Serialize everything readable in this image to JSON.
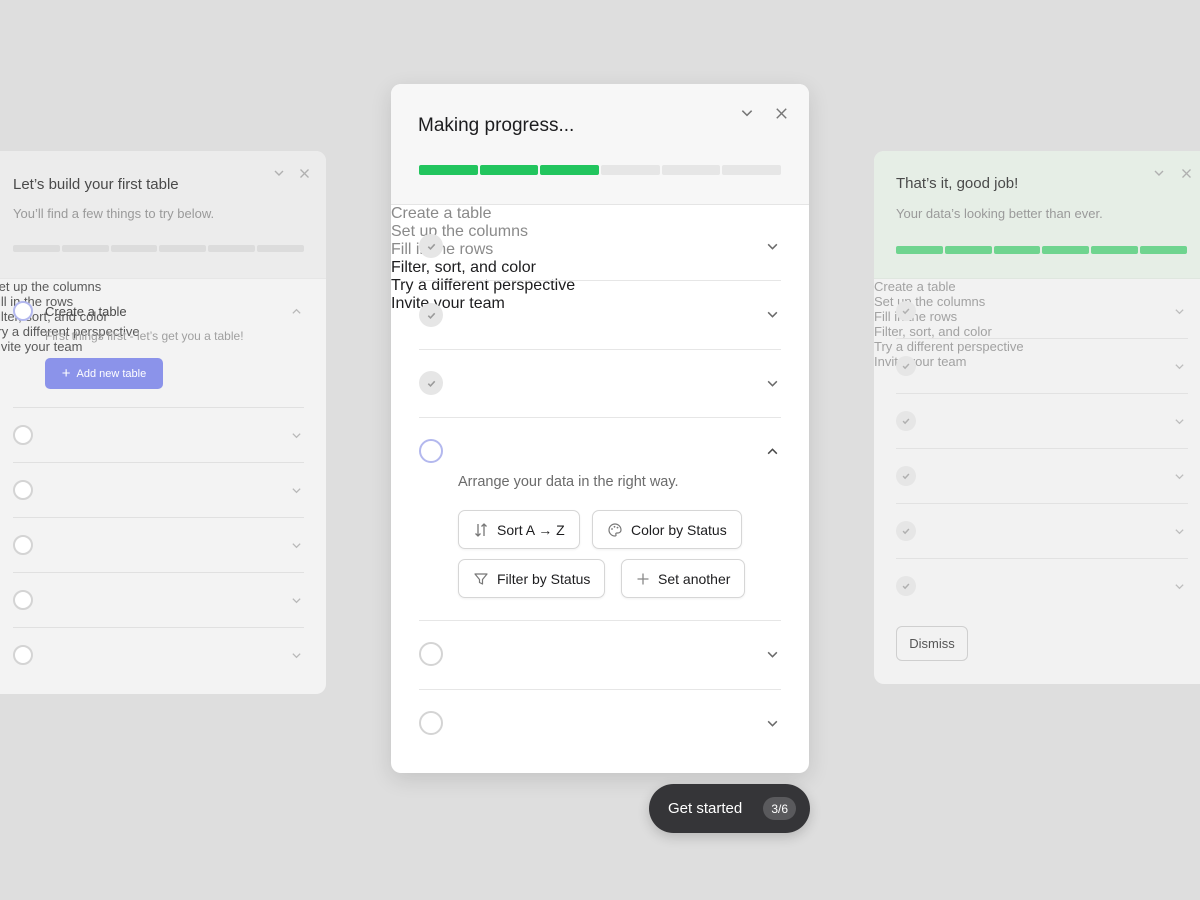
{
  "left_card": {
    "title": "Let’s build your first table",
    "subtitle": "You’ll find a few things to try below.",
    "progress": {
      "completed": 0,
      "total": 6
    },
    "items": [
      {
        "label": "Create a table",
        "state": "active",
        "expanded": true
      },
      {
        "label": "Set up the columns",
        "state": "pending"
      },
      {
        "label": "Fill in the rows",
        "state": "pending"
      },
      {
        "label": "Filter, sort, and color",
        "state": "pending"
      },
      {
        "label": "Try a different perspective",
        "state": "pending"
      },
      {
        "label": "Invite your team",
        "state": "pending"
      }
    ],
    "expanded_description": "First things first - let’s get you a table!",
    "add_button_label": "Add new table"
  },
  "center_card": {
    "title": "Making progress...",
    "progress": {
      "completed": 3,
      "total": 6
    },
    "items": [
      {
        "label": "Create a table",
        "state": "done"
      },
      {
        "label": "Set up the columns",
        "state": "done"
      },
      {
        "label": "Fill in the rows",
        "state": "done"
      },
      {
        "label": "Filter, sort, and color",
        "state": "active",
        "expanded": true
      },
      {
        "label": "Try a different perspective",
        "state": "pending"
      },
      {
        "label": "Invite your team",
        "state": "pending"
      }
    ],
    "expanded_description": "Arrange your data in the right way.",
    "actions": {
      "sort": "Sort A → Z",
      "color": "Color by Status",
      "filter": "Filter by Status",
      "another": "Set another"
    }
  },
  "get_started": {
    "label": "Get started",
    "count": "3/6"
  },
  "right_card": {
    "title": "That’s it, good job!",
    "subtitle": "Your data’s looking better than ever.",
    "progress": {
      "completed": 6,
      "total": 6
    },
    "items": [
      {
        "label": "Create a table",
        "state": "done"
      },
      {
        "label": "Set up the columns",
        "state": "done"
      },
      {
        "label": "Fill in the rows",
        "state": "done"
      },
      {
        "label": "Filter, sort, and color",
        "state": "done"
      },
      {
        "label": "Try a different perspective",
        "state": "done"
      },
      {
        "label": "Invite your team",
        "state": "done"
      }
    ],
    "dismiss_label": "Dismiss"
  },
  "colors": {
    "progress_done": "#22c55e",
    "accent": "#8b93ea",
    "pill_bg": "#353538"
  }
}
